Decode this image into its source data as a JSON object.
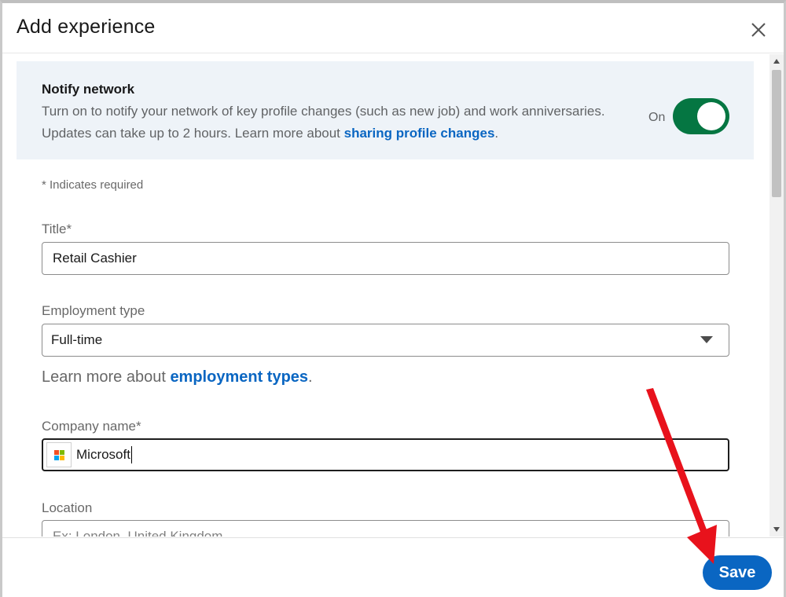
{
  "dialog": {
    "title": "Add experience",
    "close_icon": "close-icon"
  },
  "notify": {
    "title": "Notify network",
    "description": "Turn on to notify your network of key profile changes (such as new job) and work anniversaries. Updates can take up to 2 hours. Learn more about ",
    "link_text": "sharing profile changes",
    "period": ".",
    "toggle_label": "On",
    "toggle_on": true
  },
  "form": {
    "required_note": "* Indicates required",
    "title_label": "Title*",
    "title_value": "Retail Cashier",
    "employment_label": "Employment type",
    "employment_value": "Full-time",
    "learn_prefix": "Learn more about ",
    "learn_link": "employment types",
    "learn_suffix": ".",
    "company_label": "Company name*",
    "company_value": "Microsoft",
    "location_label": "Location",
    "location_placeholder": "Ex: London, United Kingdom"
  },
  "footer": {
    "save_label": "Save"
  },
  "colors": {
    "brand_blue": "#0a66c2",
    "toggle_green": "#057642",
    "annotation_red": "#e8121c"
  }
}
